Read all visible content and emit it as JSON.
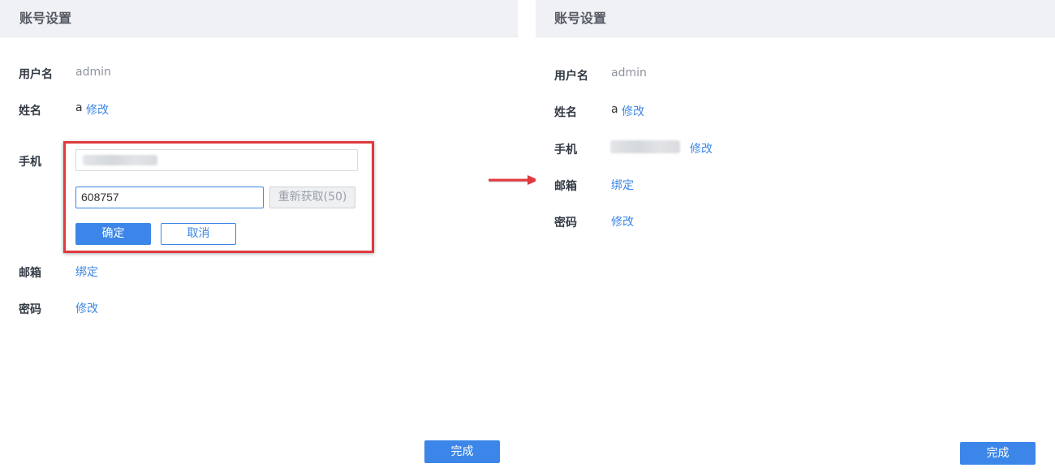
{
  "colors": {
    "accent": "#3b86e8",
    "header_bg": "#f0f1f4",
    "annotation_red": "#e0393e"
  },
  "left_panel": {
    "header_title": "账号设置",
    "username_label": "用户名",
    "username_value": "admin",
    "name_label": "姓名",
    "name_value": "a",
    "name_edit_link": "修改",
    "phone_label": "手机",
    "verification_code": "608757",
    "resend_button": "重新获取(50)",
    "confirm_button": "确定",
    "cancel_button": "取消",
    "email_label": "邮箱",
    "email_bind_link": "绑定",
    "password_label": "密码",
    "password_edit_link": "修改",
    "done_button": "完成"
  },
  "right_panel": {
    "header_title": "账号设置",
    "username_label": "用户名",
    "username_value": "admin",
    "name_label": "姓名",
    "name_value": "a",
    "name_edit_link": "修改",
    "phone_label": "手机",
    "phone_edit_link": "修改",
    "email_label": "邮箱",
    "email_bind_link": "绑定",
    "password_label": "密码",
    "password_edit_link": "修改",
    "done_button": "完成"
  },
  "annotation": {
    "arrow_icon": "right-arrow-icon"
  }
}
